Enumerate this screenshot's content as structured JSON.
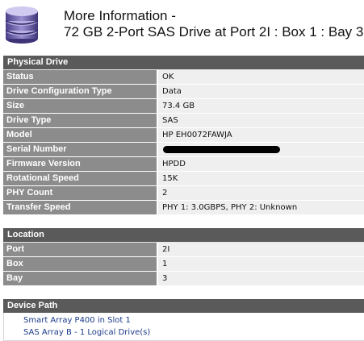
{
  "header": {
    "line1": "More Information -",
    "line2": "72 GB 2-Port SAS Drive at Port 2I : Box 1 : Bay 3",
    "icon": "drive-stack-icon"
  },
  "physical_drive": {
    "title": "Physical Drive",
    "rows": [
      {
        "label": "Status",
        "value": "OK"
      },
      {
        "label": "Drive Configuration Type",
        "value": "Data"
      },
      {
        "label": "Size",
        "value": "73.4 GB"
      },
      {
        "label": "Drive Type",
        "value": "SAS"
      },
      {
        "label": "Model",
        "value": "HP EH0072FAWJA"
      },
      {
        "label": "Serial Number",
        "value": ""
      },
      {
        "label": "Firmware Version",
        "value": "HPDD"
      },
      {
        "label": "Rotational Speed",
        "value": "15K"
      },
      {
        "label": "PHY Count",
        "value": "2"
      },
      {
        "label": "Transfer Speed",
        "value": "PHY 1: 3.0GBPS, PHY 2: Unknown"
      }
    ]
  },
  "location": {
    "title": "Location",
    "rows": [
      {
        "label": "Port",
        "value": "2I"
      },
      {
        "label": "Box",
        "value": "1"
      },
      {
        "label": "Bay",
        "value": "3"
      }
    ]
  },
  "device_path": {
    "title": "Device Path",
    "links": [
      "Smart Array P400 in Slot 1",
      "SAS Array B - 1 Logical Drive(s)"
    ]
  },
  "colors": {
    "section_header": "#5a5a5a",
    "label_bg": "#8c8c8c",
    "value_bg": "#efefef",
    "link": "#1a3a8a",
    "logo_purple": "#7b6fb3"
  }
}
